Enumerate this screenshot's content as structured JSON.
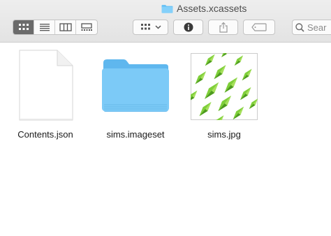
{
  "window": {
    "title": "Assets.xcassets",
    "title_icon": "folder-icon"
  },
  "toolbar": {
    "view_modes": [
      {
        "name": "icon-view",
        "icon": "grid-icon",
        "active": true
      },
      {
        "name": "list-view",
        "icon": "list-icon",
        "active": false
      },
      {
        "name": "column-view",
        "icon": "columns-icon",
        "active": false
      },
      {
        "name": "gallery-view",
        "icon": "gallery-icon",
        "active": false
      }
    ],
    "arrange_icon": "grid-dropdown-icon",
    "info_icon": "info-icon",
    "share_icon": "share-icon",
    "tag_icon": "tag-icon",
    "search_placeholder": "Sear"
  },
  "files": [
    {
      "name": "Contents.json",
      "kind": "document"
    },
    {
      "name": "sims.imageset",
      "kind": "folder"
    },
    {
      "name": "sims.jpg",
      "kind": "image"
    }
  ],
  "colors": {
    "folder_blue": "#6cc3f5",
    "active_segment": "#6b6b6b",
    "plumbob_green": "#6fbf2e"
  }
}
